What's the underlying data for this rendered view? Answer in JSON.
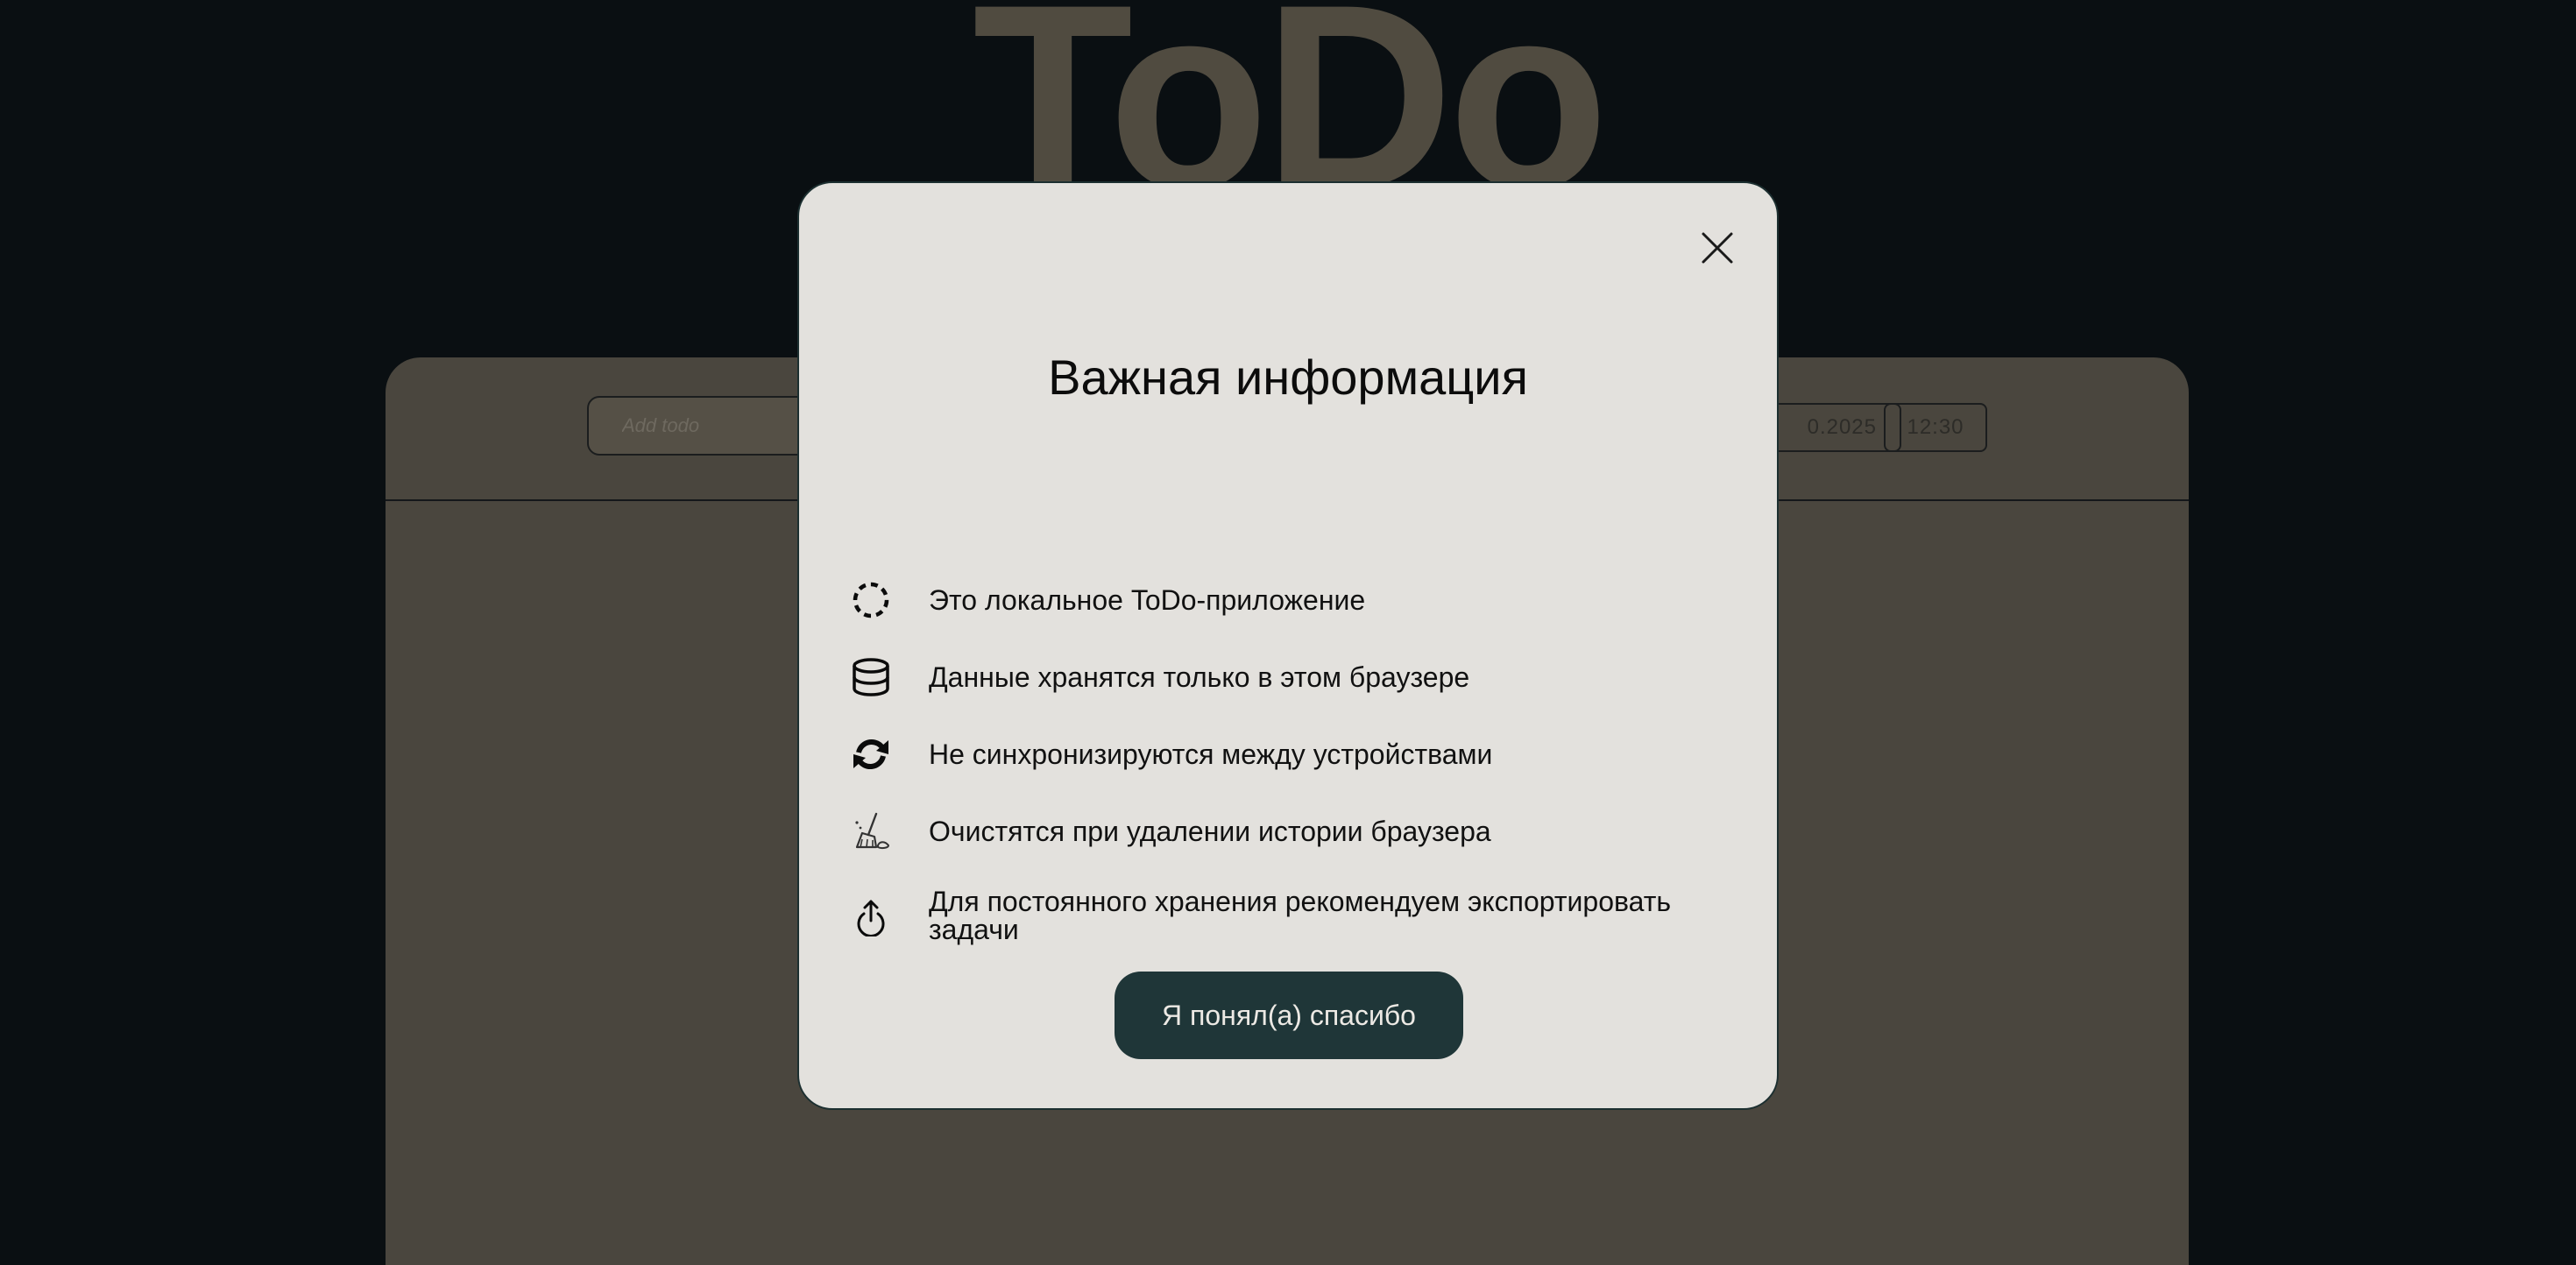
{
  "app": {
    "title": "ToDo"
  },
  "toolbar": {
    "add_placeholder": "Add todo",
    "date_value": "0.2025",
    "time_value": "12:30"
  },
  "modal": {
    "title": "Важная информация",
    "close_icon": "close-icon",
    "items": [
      {
        "icon": "dashed-circle-icon",
        "text": "Это локальное ToDo-приложение"
      },
      {
        "icon": "database-icon",
        "text": "Данные хранятся только в этом браузере"
      },
      {
        "icon": "sync-icon",
        "text": "Не синхронизируются между устройствами"
      },
      {
        "icon": "broom-icon",
        "text": "Очистятся при удалении истории браузера"
      },
      {
        "icon": "export-icon",
        "text": "Для постоянного хранения рекомендуем экспортировать задачи"
      }
    ],
    "confirm_label": "Я понял(а) спасибо"
  },
  "colors": {
    "page_bg": "#0a0f12",
    "panel_bg": "#4a463e",
    "modal_bg": "#e3e1dd",
    "button_bg": "#1f3638",
    "button_text": "#ece9e4",
    "title_muted": "#504b40"
  }
}
